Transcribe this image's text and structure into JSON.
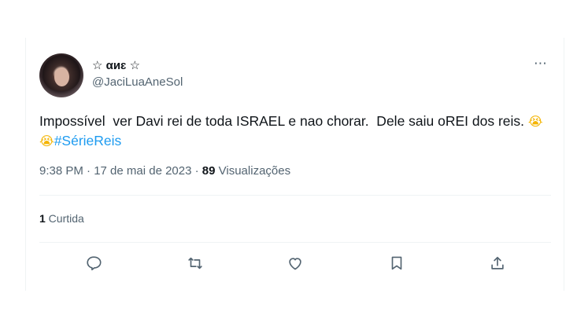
{
  "tweet": {
    "display_name": "☆ αиɛ ☆",
    "username": "@JaciLuaAneSol",
    "more_icon": "⋯",
    "text_main": "Impossível  ver Davi rei de toda ISRAEL e nao chorar.  Dele saiu oREI dos reis. ",
    "emoji_1": "😭",
    "emoji_2": "😭",
    "hashtag": "#SérieReis",
    "time": "9:38 PM · 17 de mai de 2023 · ",
    "views_count": "89",
    "views_label": " Visualizações",
    "likes_count": "1",
    "likes_label": " Curtida"
  },
  "actions": {
    "reply_icon": "reply-icon",
    "retweet_icon": "retweet-icon",
    "like_icon": "like-icon",
    "bookmark_icon": "bookmark-icon",
    "share_icon": "share-icon"
  },
  "colors": {
    "text": "#0f1419",
    "secondary": "#536471",
    "accent": "#1d9bf0",
    "border": "#eff3f4"
  }
}
